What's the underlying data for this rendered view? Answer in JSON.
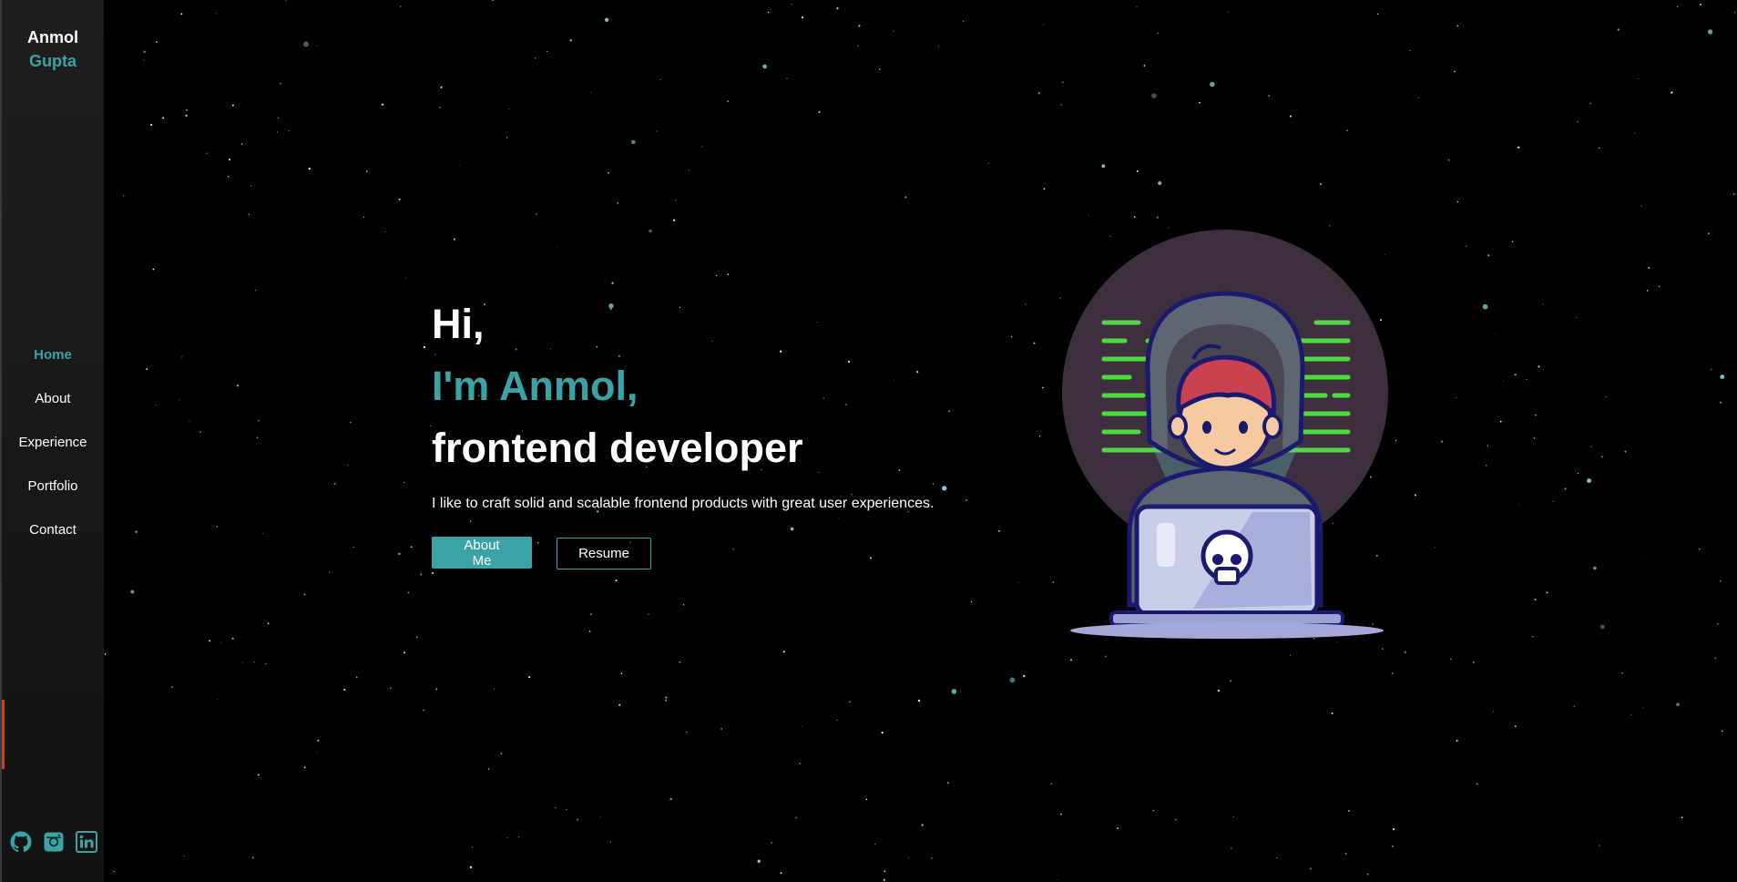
{
  "brand": {
    "first_name": "Anmol",
    "last_name": "Gupta"
  },
  "nav": {
    "items": [
      {
        "label": "Home",
        "active": true
      },
      {
        "label": "About",
        "active": false
      },
      {
        "label": "Experience",
        "active": false
      },
      {
        "label": "Portfolio",
        "active": false
      },
      {
        "label": "Contact",
        "active": false
      }
    ]
  },
  "social": {
    "icons": [
      "github-icon",
      "instagram-icon",
      "linkedin-icon"
    ]
  },
  "hero": {
    "greeting": "Hi,",
    "intro": "I'm Anmol,",
    "role": "frontend developer",
    "tagline": "I like to craft solid and scalable frontend products with great user experiences.",
    "primary_button": "About Me",
    "secondary_button": "Resume"
  },
  "colors": {
    "accent": "#3aa3a8",
    "background": "#000000",
    "sidebar": "#1a1a1a",
    "code_lines": "#4ddc3f"
  }
}
